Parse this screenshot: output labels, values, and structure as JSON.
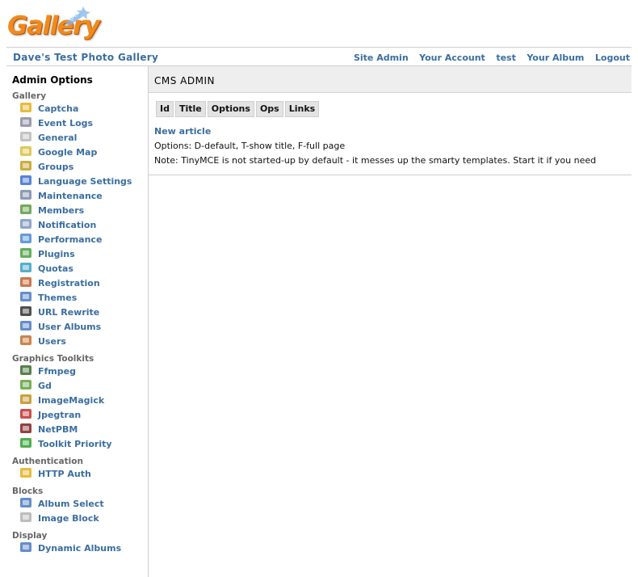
{
  "logo": {
    "text": "Gallery"
  },
  "site_title": "Dave's Test Photo Gallery",
  "top_links": [
    "Site Admin",
    "Your Account",
    "test",
    "Your Album",
    "Logout"
  ],
  "sidebar": {
    "heading": "Admin Options",
    "sections": [
      {
        "title": "Gallery",
        "items": [
          {
            "label": "Captcha",
            "icon": "shield-icon",
            "color": "#e0b020"
          },
          {
            "label": "Event Logs",
            "icon": "log-icon",
            "color": "#8a8aa0"
          },
          {
            "label": "General",
            "icon": "pages-icon",
            "color": "#b8b8b8"
          },
          {
            "label": "Google Map",
            "icon": "map-icon",
            "color": "#d8c040"
          },
          {
            "label": "Groups",
            "icon": "gears-icon",
            "color": "#c0a020"
          },
          {
            "label": "Language Settings",
            "icon": "language-icon",
            "color": "#3b6fd0"
          },
          {
            "label": "Maintenance",
            "icon": "wrench-icon",
            "color": "#7a8aa8"
          },
          {
            "label": "Members",
            "icon": "people-icon",
            "color": "#5a9a40"
          },
          {
            "label": "Notification",
            "icon": "envelope-icon",
            "color": "#7a96c0"
          },
          {
            "label": "Performance",
            "icon": "clock-icon",
            "color": "#4a8ad0"
          },
          {
            "label": "Plugins",
            "icon": "puzzle-icon",
            "color": "#4aa040"
          },
          {
            "label": "Quotas",
            "icon": "pie-icon",
            "color": "#3aa0c0"
          },
          {
            "label": "Registration",
            "icon": "person-add-icon",
            "color": "#c06030"
          },
          {
            "label": "Themes",
            "icon": "window-icon",
            "color": "#4a7ac0"
          },
          {
            "label": "URL Rewrite",
            "icon": "url-icon",
            "color": "#303030"
          },
          {
            "label": "User Albums",
            "icon": "album-icon",
            "color": "#4a7ac0"
          },
          {
            "label": "Users",
            "icon": "person-icon",
            "color": "#c07030"
          }
        ]
      },
      {
        "title": "Graphics Toolkits",
        "items": [
          {
            "label": "Ffmpeg",
            "icon": "film-icon",
            "color": "#3a6a30"
          },
          {
            "label": "Gd",
            "icon": "gd-icon",
            "color": "#60a040"
          },
          {
            "label": "ImageMagick",
            "icon": "wand-icon",
            "color": "#c09020"
          },
          {
            "label": "Jpegtran",
            "icon": "jpg-icon",
            "color": "#c03030"
          },
          {
            "label": "NetPBM",
            "icon": "pbm-icon",
            "color": "#802020"
          },
          {
            "label": "Toolkit Priority",
            "icon": "arrows-icon",
            "color": "#30a030"
          }
        ]
      },
      {
        "title": "Authentication",
        "items": [
          {
            "label": "HTTP Auth",
            "icon": "key-icon",
            "color": "#e0b020"
          }
        ]
      },
      {
        "title": "Blocks",
        "items": [
          {
            "label": "Album Select",
            "icon": "album-select-icon",
            "color": "#4a7ac0"
          },
          {
            "label": "Image Block",
            "icon": "cube-icon",
            "color": "#b0b0b0"
          }
        ]
      },
      {
        "title": "Display",
        "items": [
          {
            "label": "Dynamic Albums",
            "icon": "dynamic-album-icon",
            "color": "#4a7ac0"
          }
        ]
      }
    ]
  },
  "main": {
    "title": "CMS ADMIN",
    "tabs": [
      "Id",
      "Title",
      "Options",
      "Ops",
      "Links"
    ],
    "new_article": "New article",
    "options_text": "Options: D-default, T-show title, F-full page",
    "note_text": "Note: TinyMCE is not started-up by default - it messes up the smarty templates. Start it if you need"
  }
}
